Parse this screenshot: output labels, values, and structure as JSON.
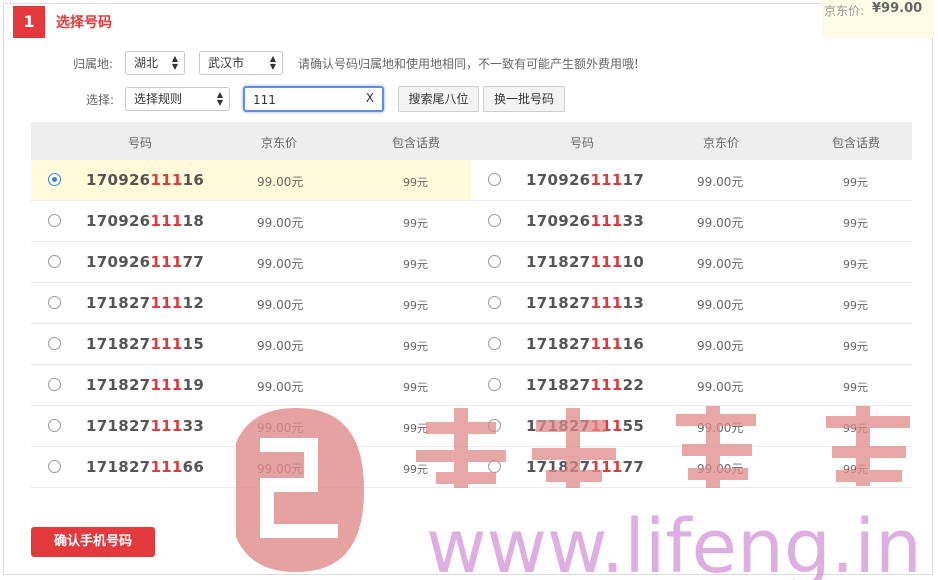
{
  "step": {
    "number": "1",
    "title": "选择号码"
  },
  "price": {
    "label": "京东价:",
    "value": "¥99.00"
  },
  "location": {
    "label": "归属地:",
    "province": "湖北",
    "city": "武汉市",
    "hint": "请确认号码归属地和使用地相同，不一致有可能产生额外费用哦!"
  },
  "filter": {
    "label": "选择:",
    "rule": "选择规则",
    "search_value": "111",
    "clear": "X",
    "search_button": "搜索尾八位",
    "refresh_button": "换一批号码"
  },
  "table": {
    "headers": [
      "号码",
      "京东价",
      "包含话费",
      "号码",
      "京东价",
      "包含话费"
    ],
    "rows": [
      [
        {
          "prefix": "170926",
          "hl": "111",
          "suffix": "16",
          "price": "99.00元",
          "fee": "99元",
          "selected": true
        },
        {
          "prefix": "170926",
          "hl": "111",
          "suffix": "17",
          "price": "99.00元",
          "fee": "99元",
          "selected": false
        }
      ],
      [
        {
          "prefix": "170926",
          "hl": "111",
          "suffix": "18",
          "price": "99.00元",
          "fee": "99元",
          "selected": false
        },
        {
          "prefix": "170926",
          "hl": "111",
          "suffix": "33",
          "price": "99.00元",
          "fee": "99元",
          "selected": false
        }
      ],
      [
        {
          "prefix": "170926",
          "hl": "111",
          "suffix": "77",
          "price": "99.00元",
          "fee": "99元",
          "selected": false
        },
        {
          "prefix": "171827",
          "hl": "111",
          "suffix": "10",
          "price": "99.00元",
          "fee": "99元",
          "selected": false
        }
      ],
      [
        {
          "prefix": "171827",
          "hl": "111",
          "suffix": "12",
          "price": "99.00元",
          "fee": "99元",
          "selected": false
        },
        {
          "prefix": "171827",
          "hl": "111",
          "suffix": "13",
          "price": "99.00元",
          "fee": "99元",
          "selected": false
        }
      ],
      [
        {
          "prefix": "171827",
          "hl": "111",
          "suffix": "15",
          "price": "99.00元",
          "fee": "99元",
          "selected": false
        },
        {
          "prefix": "171827",
          "hl": "111",
          "suffix": "16",
          "price": "99.00元",
          "fee": "99元",
          "selected": false
        }
      ],
      [
        {
          "prefix": "171827",
          "hl": "111",
          "suffix": "19",
          "price": "99.00元",
          "fee": "99元",
          "selected": false
        },
        {
          "prefix": "171827",
          "hl": "111",
          "suffix": "22",
          "price": "99.00元",
          "fee": "99元",
          "selected": false
        }
      ],
      [
        {
          "prefix": "171827",
          "hl": "111",
          "suffix": "33",
          "price": "99.00元",
          "fee": "99元",
          "selected": false
        },
        {
          "prefix": "171827",
          "hl": "111",
          "suffix": "55",
          "price": "99.00元",
          "fee": "99元",
          "selected": false
        }
      ],
      [
        {
          "prefix": "171827",
          "hl": "111",
          "suffix": "66",
          "price": "99.00元",
          "fee": "99元",
          "selected": false
        },
        {
          "prefix": "171827",
          "hl": "111",
          "suffix": "77",
          "price": "99.00元",
          "fee": "99元",
          "selected": false
        }
      ]
    ]
  },
  "confirm_button": "确认手机号码",
  "watermark": {
    "text": "www.lifeng.in",
    "color_logo": "#e08a8a",
    "color_text": "#c97ad0"
  },
  "colors": {
    "accent": "#e4393c",
    "selected_row": "#fffbd8",
    "header_bg": "#eeeeee",
    "focus": "#5b8def"
  }
}
